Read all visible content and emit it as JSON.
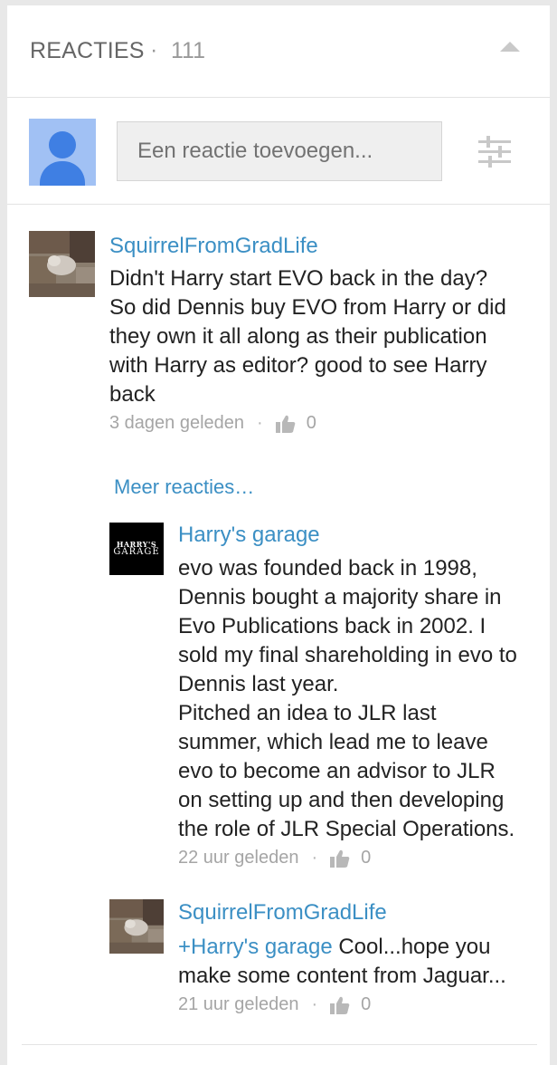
{
  "header": {
    "title": "REACTIES",
    "separator": "·",
    "count": "111"
  },
  "compose": {
    "placeholder": "Een reactie toevoegen..."
  },
  "comments": [
    {
      "author": "SquirrelFromGradLife",
      "lines": [
        "Didn't Harry start EVO back in the day?",
        "So did Dennis buy EVO from Harry or did",
        "they own it all along as their publication",
        "with Harry as editor? good to see Harry",
        "back"
      ],
      "time": "3 dagen geleden",
      "likes": "0"
    }
  ],
  "more_replies_label": "Meer reacties…",
  "replies": [
    {
      "author": "Harry's garage",
      "logo_line1": "HARRY'S",
      "logo_line2": "GARAGE",
      "lines": [
        "evo was founded back in 1998,",
        "Dennis bought a majority share in",
        "Evo Publications back in 2002. I",
        "sold my final shareholding in evo to",
        "Dennis last year.",
        "Pitched an idea to JLR last",
        "summer, which lead me to leave",
        "evo to become an advisor to JLR",
        "on setting up and then developing",
        "the role of JLR Special Operations."
      ],
      "time": "22 uur geleden",
      "likes": "0"
    },
    {
      "author": "SquirrelFromGradLife",
      "mention": "+Harry's garage",
      "line1_rest": " Cool...hope you",
      "line2": "make some content from Jaguar...",
      "time": "21 uur geleden",
      "likes": "0"
    }
  ],
  "meta_separator": "·",
  "colors": {
    "link": "#3b8fc4",
    "text": "#222222",
    "meta": "#a5a5a5",
    "avatar_bg": "#a1c1f4",
    "avatar_fg": "#3f7fe3"
  },
  "icons": {
    "collapse": "triangle-up-icon",
    "sort": "sliders-icon",
    "like": "thumbs-up-icon"
  }
}
